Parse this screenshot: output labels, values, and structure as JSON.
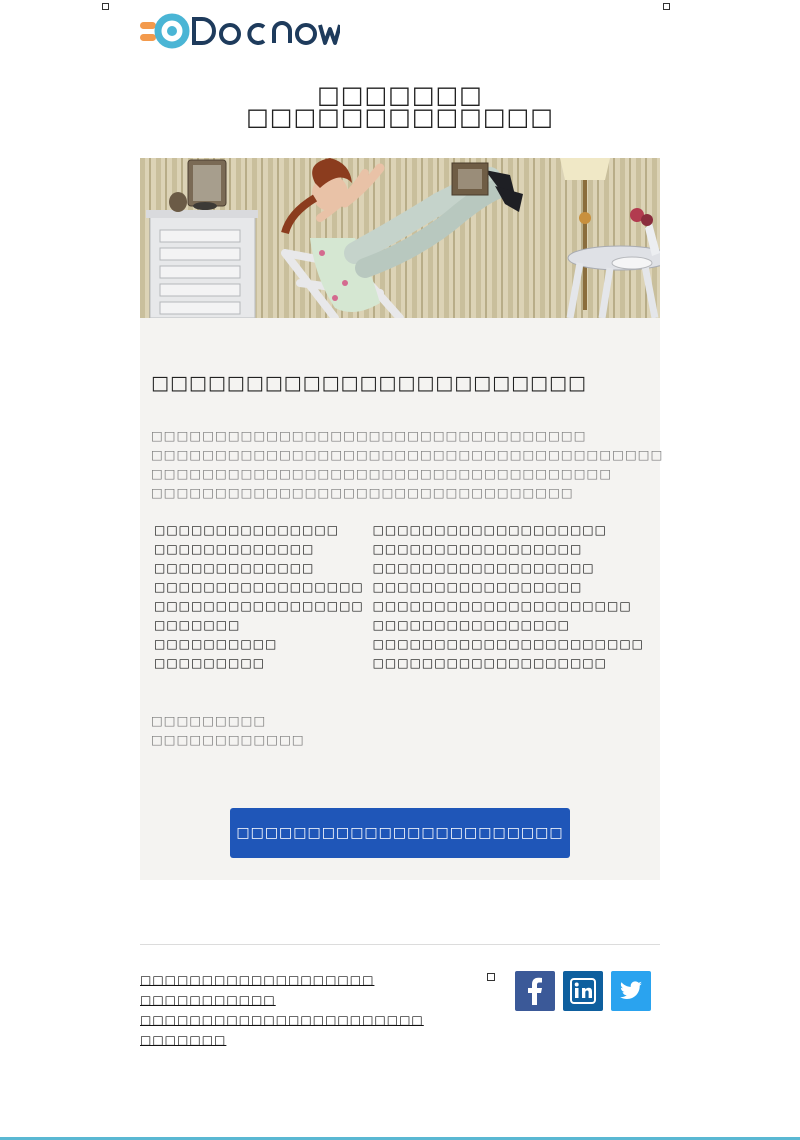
{
  "brand": {
    "name": "DOCNOW",
    "accent_orange": "#f39a4c",
    "accent_teal": "#4ab5d5",
    "logo_dark": "#1e3b5c"
  },
  "headline": {
    "line1": "□□□□□□□",
    "line2": "□□□□□□□□□□□□□"
  },
  "hero": {
    "icon": "hero-image"
  },
  "card": {
    "background": "#f4f3f1",
    "title": "□□□□□□□□□□□□□□□□□□□□□□□",
    "intro": "□□□□□□□□□□□□□□□□□□□□□□□□□□□□□□□□□□ □□□□□□□□□□□□□□□□□□□□□□□□□□□□□□□□□□□□□□□□ □□□□□□□□□□□□□□□□□□□□□□□□□□□□□□□□□□□□ □□□□□□□□□□□□□□□□□□□□□□□□□□□□□□□□□",
    "left_items": [
      "□□□□□□□□□□□□□□□",
      "□□□□□□□□□□□□□",
      "□□□□□□□□□□□□□",
      "□□□□□□□□□□□□□□□□□",
      "□□□□□□□□□□□□□□□□□",
      "□□□□□□□",
      "□□□□□□□□□□",
      "□□□□□□□□□"
    ],
    "right_items": [
      "□□□□□□□□□□□□□□□□□□□",
      "□□□□□□□□□□□□□□□□□",
      "□□□□□□□□□□□□□□□□□□",
      "□□□□□□□□□□□□□□□□□",
      "□□□□□□□□□□□□□□□□□□□□□",
      "□□□□□□□□□□□□□□□□",
      "□□□□□□□□□□□□□□□□□□□□□□",
      "□□□□□□□□□□□□□□□□□□□"
    ],
    "signoff_line1": "□□□□□□□□□",
    "signoff_line2": "□□□□□□□□□□□□",
    "cta_label": "□□□□□□□□□□□□□□□□□□□□□□□",
    "cta_color": "#1f56b8"
  },
  "footer": {
    "links": [
      "□□□□□□□□□□□□□□□□□□□",
      "□□□□□□□□□□□",
      "□□□□□□□□□□□□□□□□□□□□□□□",
      "□□□□□□□"
    ],
    "social": [
      {
        "icon": "facebook-icon",
        "color": "#3b5998"
      },
      {
        "icon": "linkedin-icon",
        "color": "#0e5f9e"
      },
      {
        "icon": "twitter-icon",
        "color": "#2aa3ef"
      }
    ]
  }
}
